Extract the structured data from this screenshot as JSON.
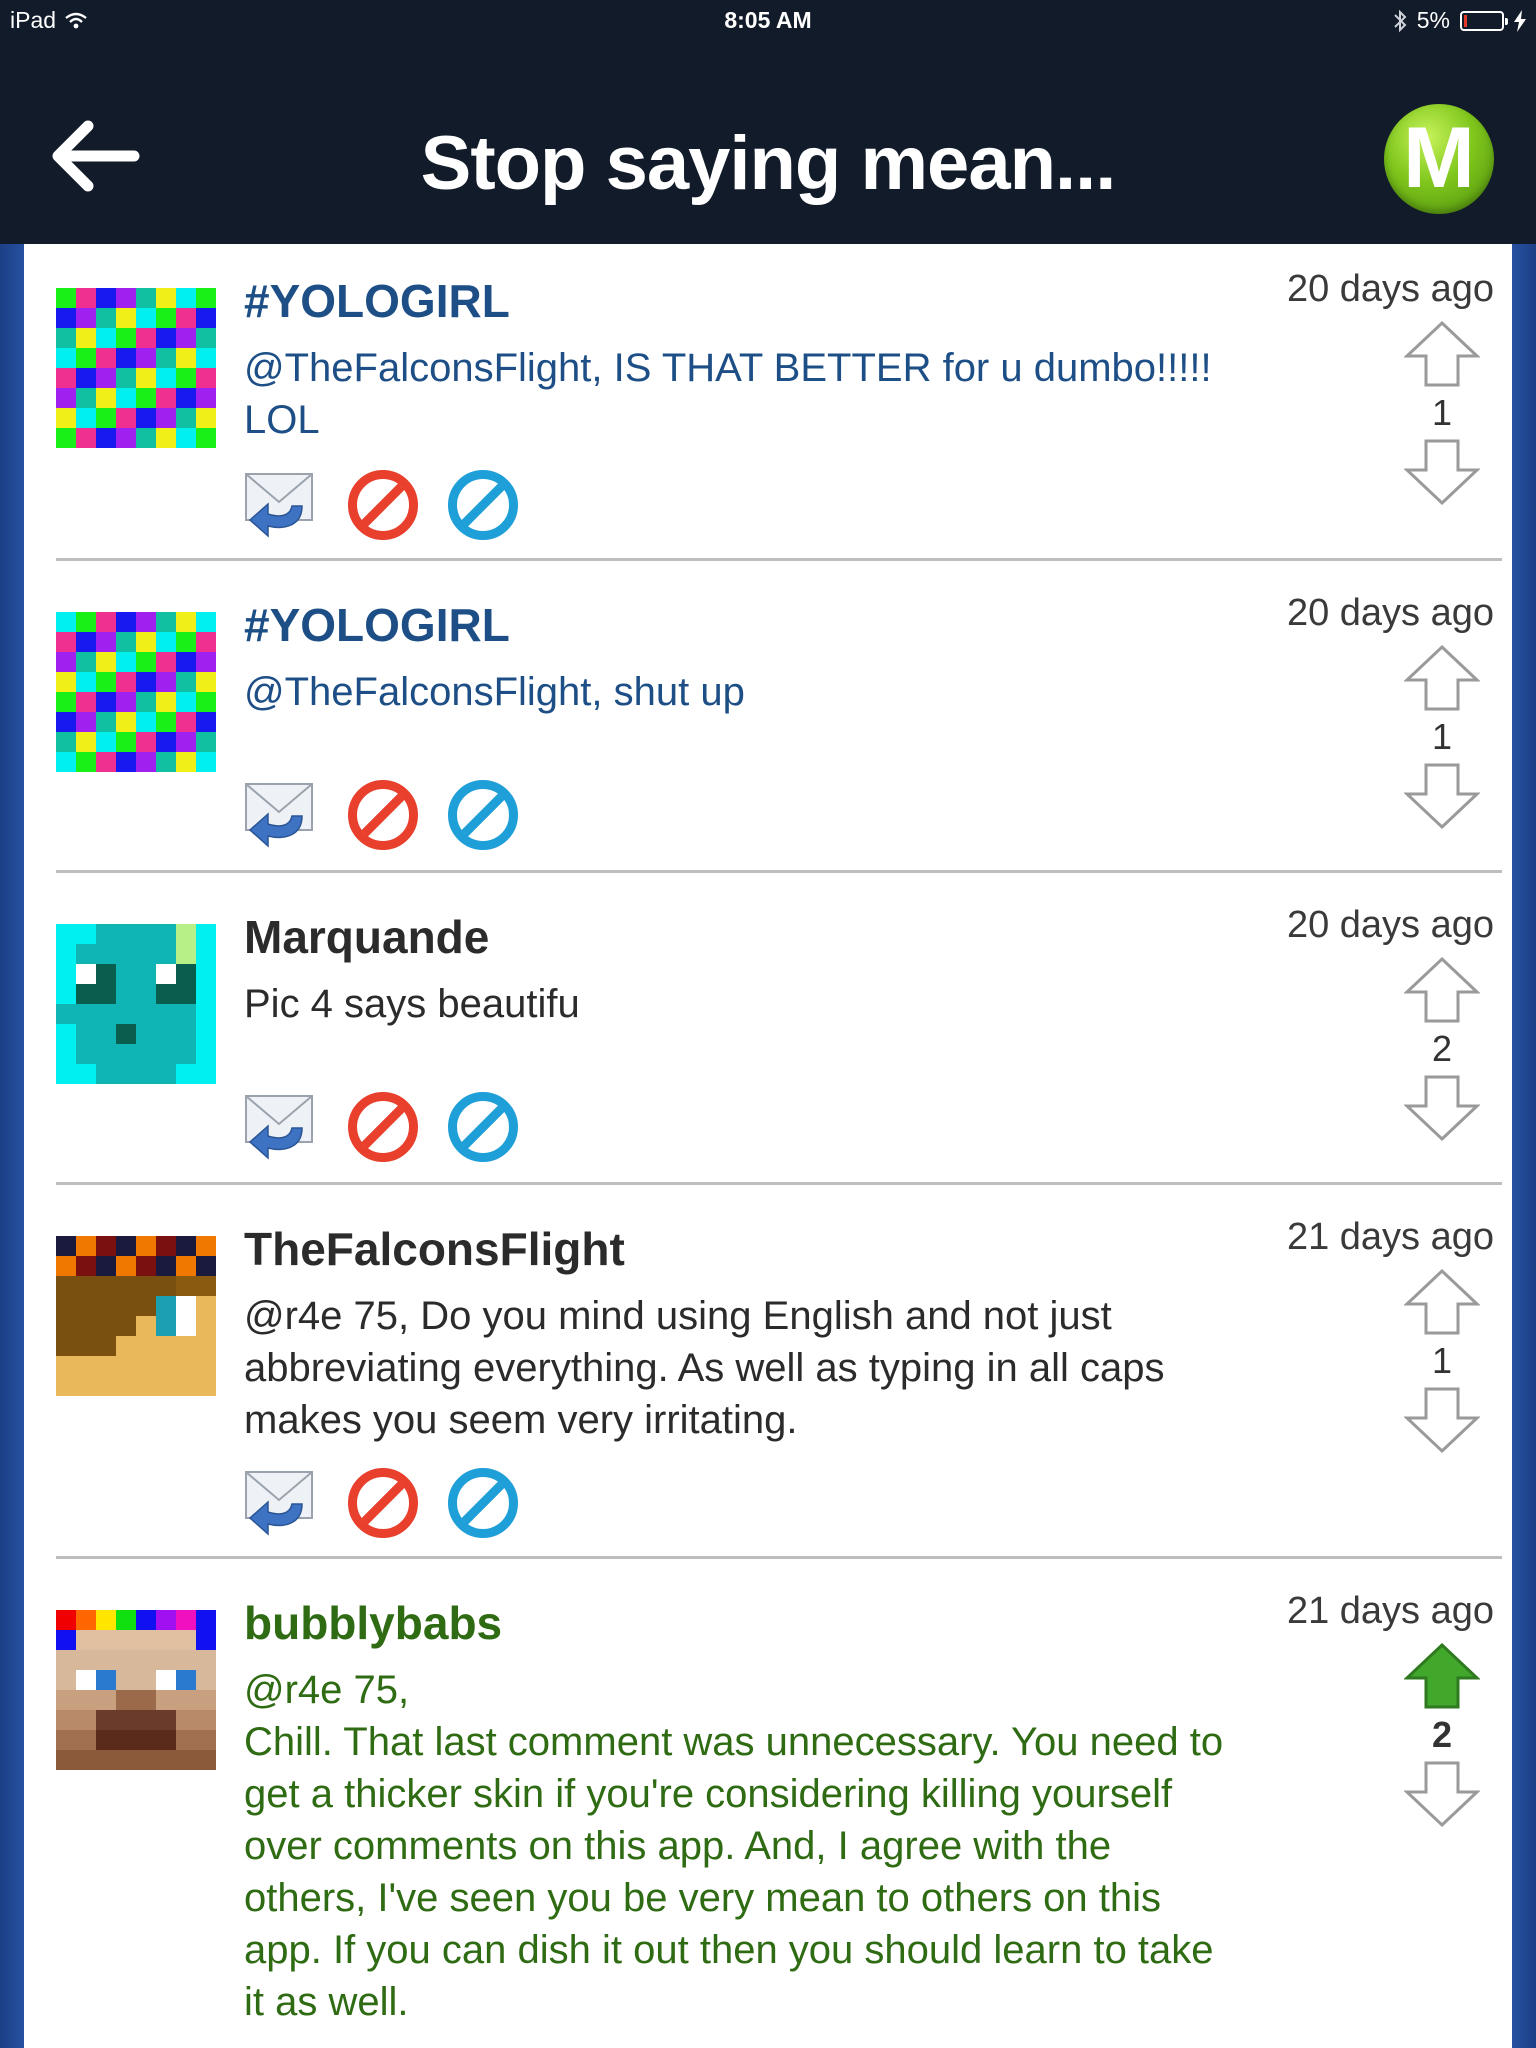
{
  "status": {
    "device": "iPad",
    "time": "8:05 AM",
    "battery": "5%"
  },
  "nav": {
    "title": "Stop saying mean...",
    "logo_letter": "M"
  },
  "colors": {
    "navy": "#121b2a",
    "blue_user": "#1d4f86",
    "dark_user": "#2b2b2b",
    "green_user": "#2e6b13",
    "upvote_active": "#42a82c"
  },
  "comments": [
    {
      "username": "#YOLOGIRL",
      "time": "20 days ago",
      "text": "@TheFalconsFlight, IS THAT BETTER for u dumbo!!!!!\nLOL",
      "votes": "1"
    },
    {
      "username": "#YOLOGIRL",
      "time": "20 days ago",
      "text": "@TheFalconsFlight, shut up",
      "votes": "1"
    },
    {
      "username": "Marquande",
      "time": "20 days ago",
      "text": "Pic 4 says beautifu",
      "votes": "2"
    },
    {
      "username": "TheFalconsFlight",
      "time": "21 days ago",
      "text": "@r4e 75, Do you mind using English and not just\nabbreviating everything. As well as typing in all caps\nmakes you seem very irritating.",
      "votes": "1"
    },
    {
      "username": "bubblybabs",
      "time": "21 days ago",
      "text": "@r4e 75,\nChill. That last comment was unnecessary. You need to\nget a thicker skin if you're considering killing yourself\nover comments on this app. And, I agree with the\nothers, I've seen you be very mean to others on this\napp. If you can dish it out then you should learn to take\nit as well.",
      "votes": "2"
    }
  ]
}
